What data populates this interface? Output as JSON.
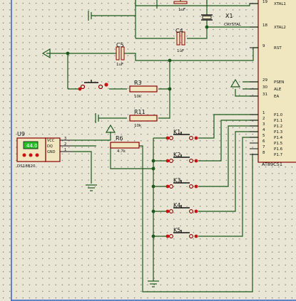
{
  "colors": {
    "background": "#eae6d6",
    "grid_dot": "#7a7a7a",
    "wire": "#1a5a1a",
    "component_body": "#f0e6c0",
    "component_outline": "#8b0000",
    "pin_end": "#cc1111",
    "lcd_green": "#25c025",
    "window_blue": "#3a5fcd"
  },
  "mcu": {
    "part": "AT89C51",
    "left_pins": [
      {
        "num": "19",
        "name": "XTAL1"
      },
      {
        "num": "18",
        "name": "XTAL2"
      },
      {
        "num": "9",
        "name": "RST"
      },
      {
        "num": "29",
        "name": "PSEN"
      },
      {
        "num": "30",
        "name": "ALE"
      },
      {
        "num": "31",
        "name": "EA"
      },
      {
        "num": "1",
        "name": "P1.0"
      },
      {
        "num": "2",
        "name": "P1.1"
      },
      {
        "num": "3",
        "name": "P1.2"
      },
      {
        "num": "4",
        "name": "P1.3"
      },
      {
        "num": "5",
        "name": "P1.4"
      },
      {
        "num": "6",
        "name": "P1.5"
      },
      {
        "num": "7",
        "name": "P1.6"
      },
      {
        "num": "8",
        "name": "P1.7"
      }
    ]
  },
  "crystal": {
    "ref": "X1",
    "value": "CRYSTAL"
  },
  "capacitors": [
    {
      "ref": "",
      "value": "1uF"
    },
    {
      "ref": "C4",
      "value": "1uF"
    },
    {
      "ref": "C5",
      "value": "1uF"
    }
  ],
  "resistors": [
    {
      "ref": "R3",
      "value": "10k"
    },
    {
      "ref": "R11",
      "value": "10k"
    },
    {
      "ref": "R6",
      "value": "4.7k"
    }
  ],
  "keys": [
    "K1",
    "K2",
    "K3",
    "K4",
    "K5"
  ],
  "sensor": {
    "ref": "U9",
    "part": "DS18B20",
    "display": "44.0",
    "pins": [
      {
        "num": "3",
        "name": "VCC"
      },
      {
        "num": "2",
        "name": "DQ"
      },
      {
        "num": "1",
        "name": "GND"
      }
    ]
  }
}
